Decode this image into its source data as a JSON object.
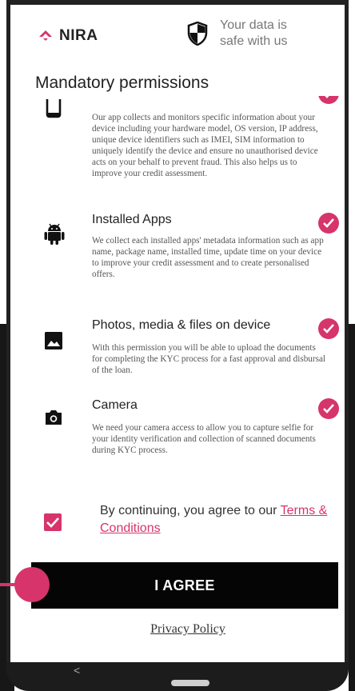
{
  "header": {
    "brand": "NIRA",
    "safe_line1": "Your data is",
    "safe_line2": "safe with us"
  },
  "title": "Mandatory permissions",
  "permissions": [
    {
      "title": "",
      "icon": "phone-icon",
      "description": "Our app collects and monitors specific information about your device including your hardware model, OS version, IP address, unique device identifiers such as IMEI, SIM information to uniquely identify the device and ensure no unauthorised device acts on your behalf to prevent fraud. This also helps us to improve your credit assessment."
    },
    {
      "title": "Installed Apps",
      "icon": "android-icon",
      "description": "We collect each installed apps' metadata information such as app name, package name, installed time, update time on your device to improve your credit assessment and to create personalised offers."
    },
    {
      "title": "Photos, media & files on device",
      "icon": "image-icon",
      "description": "With this permission you will be able to upload the documents for completing the KYC process for a fast approval and disbursal of the loan."
    },
    {
      "title": "Camera",
      "icon": "camera-icon",
      "description": "We need your camera access to allow you to capture selfie for your identity verification and collection of scanned documents during KYC process."
    }
  ],
  "consent": {
    "checked": true,
    "text": "By continuing, you agree to our ",
    "link": "Terms & Conditions"
  },
  "agree_button": "I AGREE",
  "privacy_link": "Privacy Policy",
  "nav": {
    "back": "<"
  },
  "colors": {
    "accent": "#d6346b",
    "button": "#050505"
  }
}
